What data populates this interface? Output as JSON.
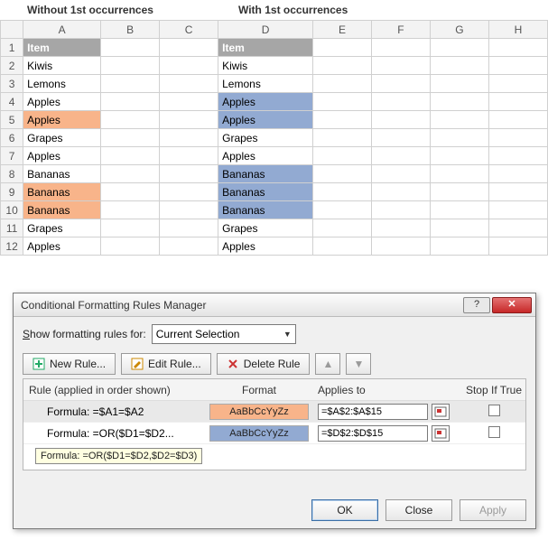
{
  "captions": {
    "left": "Without 1st occurrences",
    "right": "With 1st occurrences"
  },
  "columns": [
    "A",
    "B",
    "C",
    "D",
    "E",
    "F",
    "G",
    "H"
  ],
  "rows": [
    {
      "n": "1",
      "A": "Item",
      "D": "Item",
      "aHdr": true,
      "dHdr": true
    },
    {
      "n": "2",
      "A": "Kiwis",
      "D": "Kiwis"
    },
    {
      "n": "3",
      "A": "Lemons",
      "D": "Lemons"
    },
    {
      "n": "4",
      "A": "Apples",
      "D": "Apples",
      "dHi": true
    },
    {
      "n": "5",
      "A": "Apples",
      "D": "Apples",
      "aHi": true,
      "dHi": true
    },
    {
      "n": "6",
      "A": "Grapes",
      "D": "Grapes"
    },
    {
      "n": "7",
      "A": "Apples",
      "D": "Apples"
    },
    {
      "n": "8",
      "A": "Bananas",
      "D": "Bananas",
      "dHi": true
    },
    {
      "n": "9",
      "A": "Bananas",
      "D": "Bananas",
      "aHi": true,
      "dHi": true
    },
    {
      "n": "10",
      "A": "Bananas",
      "D": "Bananas",
      "aHi": true,
      "dHi": true
    },
    {
      "n": "11",
      "A": "Grapes",
      "D": "Grapes"
    },
    {
      "n": "12",
      "A": "Apples",
      "D": "Apples"
    }
  ],
  "dialog": {
    "title": "Conditional Formatting Rules Manager",
    "help_icon": "?",
    "close_icon": "✕",
    "showFor_label": "Show formatting rules for:",
    "showFor_value": "Current Selection",
    "buttons": {
      "new": "New Rule...",
      "edit": "Edit Rule...",
      "delete": "Delete Rule",
      "up": "▲",
      "down": "▼"
    },
    "headers": {
      "rule": "Rule (applied in order shown)",
      "format": "Format",
      "applies": "Applies to",
      "stop": "Stop If True"
    },
    "rules": [
      {
        "formula": "Formula: =$A1=$A2",
        "swatch": "sw-orange",
        "sample": "AaBbCcYyZz",
        "applies": "=$A$2:$A$15",
        "selected": true
      },
      {
        "formula": "Formula: =OR($D1=$D2...",
        "swatch": "sw-blue",
        "sample": "AaBbCcYyZz",
        "applies": "=$D$2:$D$15"
      }
    ],
    "tooltip": "Formula: =OR($D1=$D2,$D2=$D3)",
    "footer": {
      "ok": "OK",
      "close": "Close",
      "apply": "Apply"
    }
  }
}
